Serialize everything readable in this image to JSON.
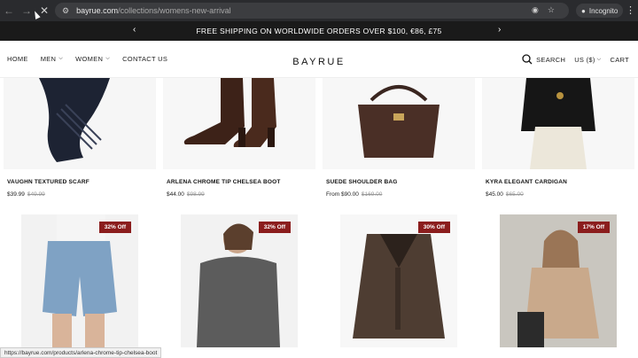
{
  "browser": {
    "url_host": "bayrue.com",
    "url_path": "/collections/womens-new-arrival",
    "incognito_label": "Incognito"
  },
  "announcement": {
    "text": "FREE SHIPPING ON WORLDWIDE ORDERS OVER $100, €86, £75"
  },
  "header": {
    "logo": "BAYRUE",
    "nav": [
      "HOME",
      "MEN",
      "WOMEN",
      "CONTACT US"
    ],
    "search_label": "SEARCH",
    "currency_label": "US ($)",
    "cart_label": "CART"
  },
  "products": [
    {
      "name": "VAUGHN TEXTURED SCARF",
      "price": "$39.99",
      "old_price": "$49.99",
      "badge": ""
    },
    {
      "name": "ARLENA CHROME TIP CHELSEA BOOT",
      "price": "$44.00",
      "old_price": "$98.99",
      "badge": ""
    },
    {
      "name": "SUEDE SHOULDER BAG",
      "price": "From $90.00",
      "old_price": "$169.00",
      "badge": ""
    },
    {
      "name": "KYRA ELEGANT CARDIGAN",
      "price": "$45.00",
      "old_price": "$65.00",
      "badge": ""
    },
    {
      "name": "",
      "price": "",
      "old_price": "",
      "badge": "32% Off"
    },
    {
      "name": "",
      "price": "",
      "old_price": "",
      "badge": "32% Off"
    },
    {
      "name": "",
      "price": "",
      "old_price": "",
      "badge": "30% Off"
    },
    {
      "name": "",
      "price": "",
      "old_price": "",
      "badge": "17% Off"
    }
  ],
  "status_bar": {
    "text": "https://bayrue.com/products/arlena-chrome-tip-chelsea-boot"
  },
  "colors": {
    "announce_bg": "#1a1a1a",
    "badge_bg": "#8b1d1d"
  }
}
